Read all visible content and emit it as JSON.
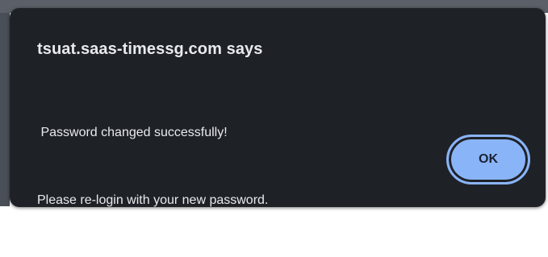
{
  "dialog": {
    "title": "tsuat.saas-timessg.com says",
    "message_line1": " Password changed successfully!",
    "message_line2": "Please re-login with your new password.",
    "ok_label": "OK"
  },
  "colors": {
    "dialog_background": "#1e2227",
    "text": "#e8eaed",
    "button_background": "#8ab4f8",
    "button_text": "#1a2332"
  }
}
